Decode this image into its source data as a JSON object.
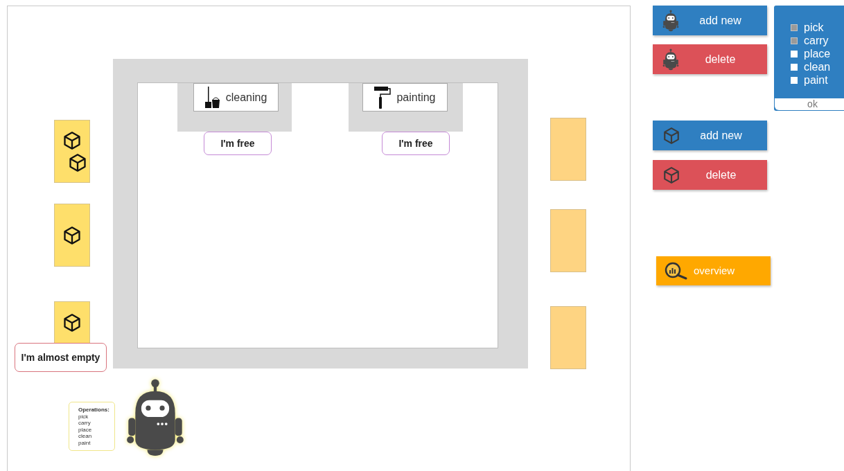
{
  "stations": [
    {
      "kind": "cleaning",
      "label": "cleaning",
      "status": "I'm free"
    },
    {
      "kind": "painting",
      "label": "painting",
      "status": "I'm free"
    }
  ],
  "input_shelves": [
    {
      "items": [
        {
          "kind": "box"
        },
        {
          "kind": "box"
        }
      ]
    },
    {
      "items": [
        {
          "kind": "box"
        }
      ]
    },
    {
      "items": [
        {
          "kind": "box"
        }
      ],
      "status": "I'm almost empty"
    }
  ],
  "output_shelves": [
    {
      "kind": "empty"
    },
    {
      "kind": "empty"
    },
    {
      "kind": "empty"
    }
  ],
  "robot": {
    "operations_title": "Operations:",
    "operations": [
      "pick",
      "carry",
      "place",
      "clean",
      "paint"
    ]
  },
  "robot_controls": [
    {
      "kind": "add",
      "label": "add new"
    },
    {
      "kind": "delete",
      "label": "delete"
    }
  ],
  "box_controls": [
    {
      "kind": "add",
      "label": "add new"
    },
    {
      "kind": "delete",
      "label": "delete"
    }
  ],
  "operations_menu": {
    "options": [
      {
        "label": "pick",
        "checked": true
      },
      {
        "label": "carry",
        "checked": true
      },
      {
        "label": "place",
        "checked": false
      },
      {
        "label": "clean",
        "checked": false
      },
      {
        "label": "paint",
        "checked": false
      }
    ],
    "ok": "ok"
  },
  "overview_button": "overview"
}
